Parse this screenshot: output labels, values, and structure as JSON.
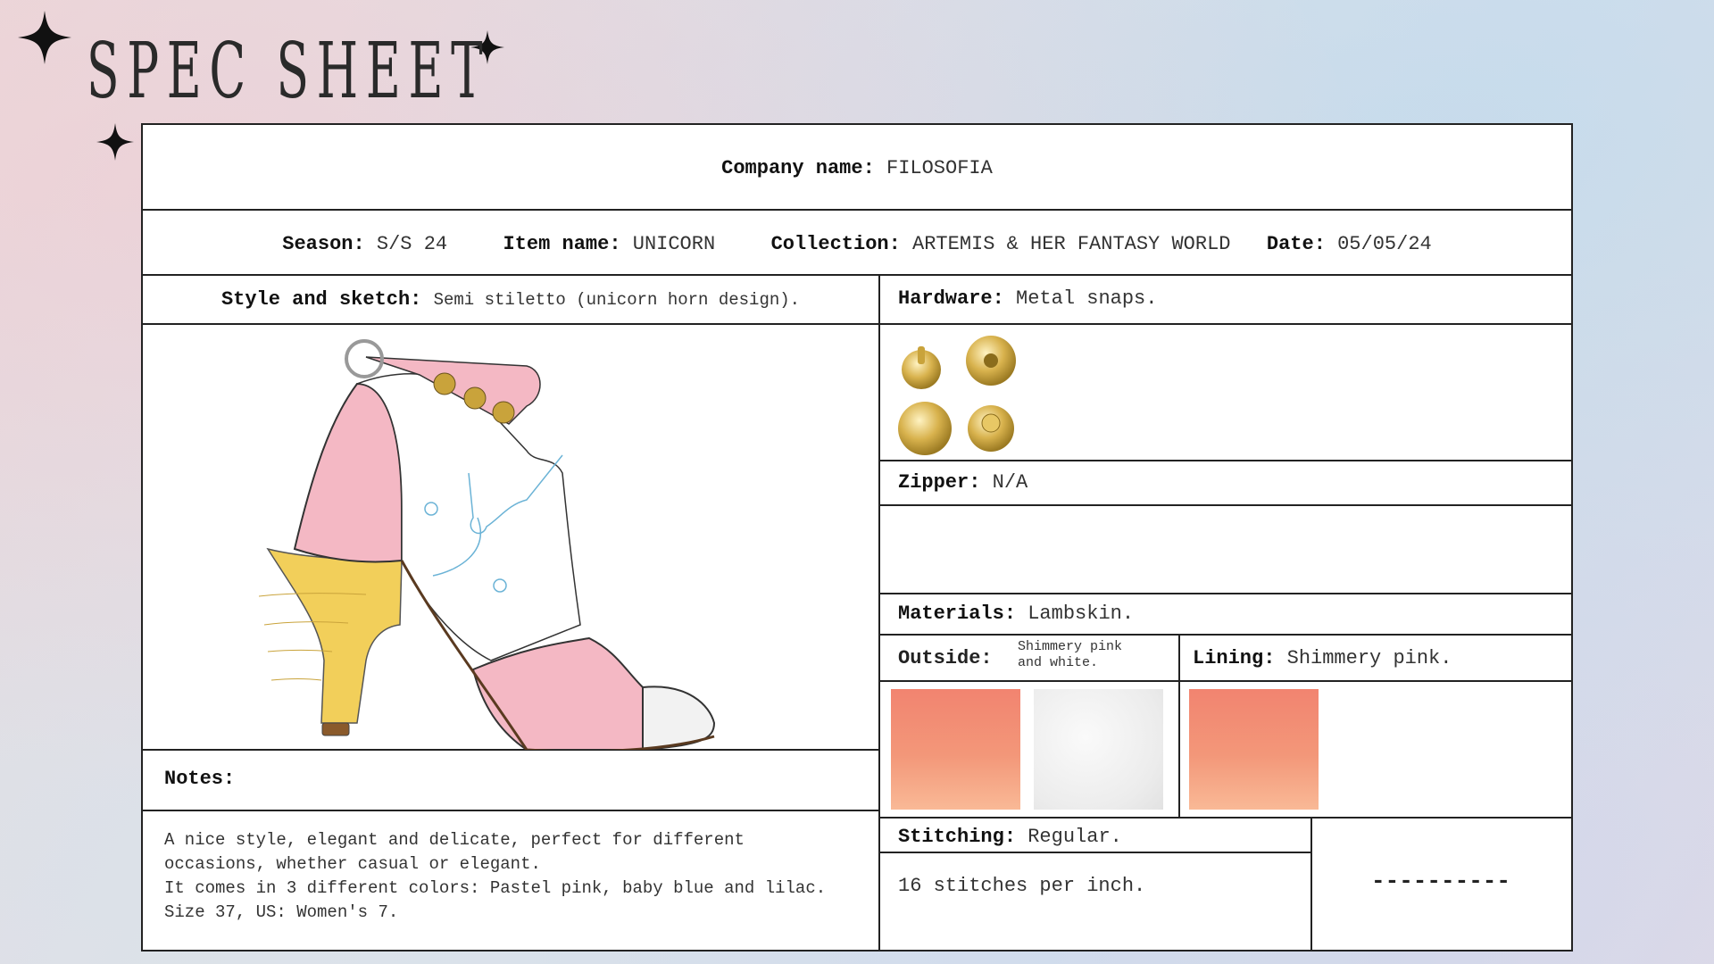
{
  "page_title": "SPEC SHEET",
  "company": {
    "label": "Company name:",
    "value": "FILOSOFIA"
  },
  "meta": {
    "season_label": "Season:",
    "season": "S/S 24",
    "item_label": "Item name:",
    "item": "UNICORN",
    "collection_label": "Collection:",
    "collection": "ARTEMIS & HER FANTASY WORLD",
    "date_label": "Date:",
    "date": "05/05/24"
  },
  "style": {
    "label": "Style and sketch:",
    "value": "Semi stiletto (unicorn horn design)."
  },
  "hardware": {
    "label": "Hardware:",
    "value": "Metal snaps."
  },
  "zipper": {
    "label": "Zipper:",
    "value": "N/A"
  },
  "materials": {
    "label": "Materials:",
    "value": "Lambskin."
  },
  "outside": {
    "label": "Outside:",
    "value": "Shimmery pink\nand white."
  },
  "lining": {
    "label": "Lining:",
    "value": "Shimmery pink."
  },
  "stitching": {
    "label": "Stitching:",
    "value": "Regular.",
    "detail": "16 stitches per inch.",
    "dashes": "----------"
  },
  "notes": {
    "label": "Notes:",
    "text": "A nice style, elegant and delicate, perfect for different\noccasions, whether casual or elegant.\nIt comes in 3 different colors: Pastel pink, baby blue and lilac.\nSize 37, US: Women's 7."
  },
  "colors": {
    "coral": "#f28470",
    "pink": "#f4b8c4",
    "heel_yellow": "#f2cf5a",
    "gold": "#c9a33b"
  },
  "icons": [
    "sparkle-icon",
    "snap-button-icon",
    "shoe-sketch"
  ]
}
